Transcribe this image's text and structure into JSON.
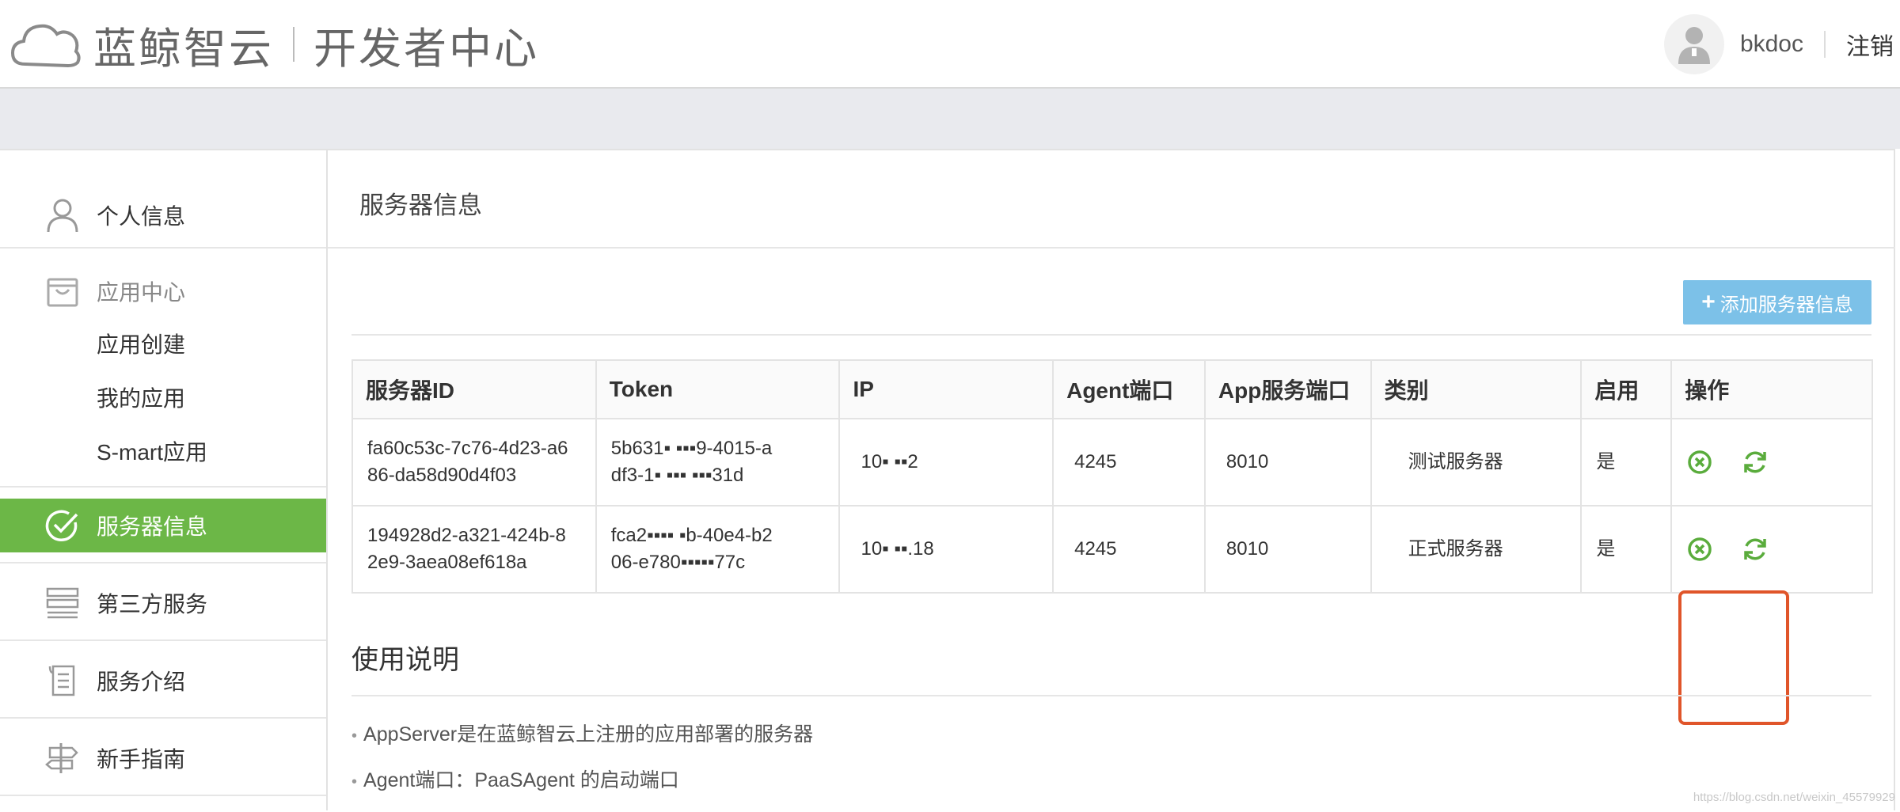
{
  "header": {
    "brand": "蓝鲸智云",
    "subtitle": "开发者中心",
    "username": "bkdoc",
    "logout_label": "注销"
  },
  "sidebar": {
    "items": [
      {
        "label": "个人信息",
        "icon": "user-icon"
      },
      {
        "label": "应用中心",
        "icon": "bag-icon"
      },
      {
        "label": "应用创建"
      },
      {
        "label": "我的应用"
      },
      {
        "label": "S-mart应用"
      },
      {
        "label": "服务器信息",
        "icon": "check-circle-icon",
        "active": true
      },
      {
        "label": "第三方服务",
        "icon": "list-icon"
      },
      {
        "label": "服务介绍",
        "icon": "scroll-icon"
      },
      {
        "label": "新手指南",
        "icon": "signpost-icon"
      }
    ]
  },
  "main": {
    "title": "服务器信息",
    "add_button": "添加服务器信息",
    "table": {
      "headers": [
        "服务器ID",
        "Token",
        "IP",
        "Agent端口",
        "App服务端口",
        "类别",
        "启用",
        "操作"
      ],
      "rows": [
        {
          "id_line1": "fa60c53c-7c76-4d23-a6",
          "id_line2": "86-da58d90d4f03",
          "token_line1": "5b631▪ ▪▪▪9-4015-a",
          "token_line2": "df3-1▪ ▪▪▪ ▪▪▪31d",
          "ip": "10▪ ▪▪2",
          "agent_port": "4245",
          "app_port": "8010",
          "category": "测试服务器",
          "enabled": "是"
        },
        {
          "id_line1": "194928d2-a321-424b-8",
          "id_line2": "2e9-3aea08ef618a",
          "token_line1": "fca2▪▪▪▪ ▪b-40e4-b2",
          "token_line2": "06-e780▪▪▪▪▪77c",
          "ip": "10▪ ▪▪.18",
          "agent_port": "4245",
          "app_port": "8010",
          "category": "正式服务器",
          "enabled": "是"
        }
      ]
    },
    "usage": {
      "title": "使用说明",
      "items": [
        "AppServer是在蓝鲸智云上注册的应用部署的服务器",
        "Agent端口：PaaSAgent 的启动端口"
      ]
    }
  },
  "watermark": "https://blog.csdn.net/weixin_45579929",
  "colors": {
    "active_nav": "#6cb747",
    "add_button": "#7cc1e8",
    "op_icon": "#5aac3c",
    "highlight": "#e0552a"
  }
}
